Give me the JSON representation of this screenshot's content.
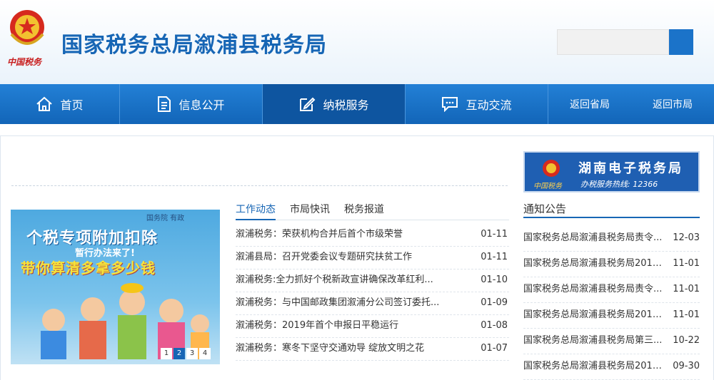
{
  "header": {
    "site_title": "国家税务总局溆浦县税务局",
    "emblem_caption": "中国税务"
  },
  "nav": [
    {
      "label": "首页",
      "icon": "home-icon"
    },
    {
      "label": "信息公开",
      "icon": "document-icon"
    },
    {
      "label": "纳税服务",
      "icon": "edit-icon"
    },
    {
      "label": "互动交流",
      "icon": "chat-icon"
    },
    {
      "label": "返回省局"
    },
    {
      "label": "返回市局"
    }
  ],
  "banner": {
    "brand": "国务院 有政",
    "line1": "个税专项附加扣除",
    "line2": "暂行办法来了!",
    "line3": "带你算清多拿多少钱",
    "pages": [
      "1",
      "2",
      "3",
      "4"
    ],
    "active_page": "2"
  },
  "news_tabs": [
    "工作动态",
    "市局快讯",
    "税务报道"
  ],
  "news": [
    {
      "title": "溆浦税务：荣获机构合并后首个市级荣誉",
      "date": "01-11"
    },
    {
      "title": "溆浦县局：召开党委会议专题研究扶贫工作",
      "date": "01-11"
    },
    {
      "title": "溆浦税务:全力抓好个税新政宣讲确保改革红利...",
      "date": "01-10"
    },
    {
      "title": "溆浦税务：与中国邮政集团溆浦分公司签订委托...",
      "date": "01-09"
    },
    {
      "title": "溆浦税务：2019年首个申报日平稳运行",
      "date": "01-08"
    },
    {
      "title": "溆浦税务：寒冬下坚守交通劝导 绽放文明之花",
      "date": "01-07"
    }
  ],
  "etax": {
    "title": "湖南电子税务局",
    "hotline": "办税服务热线: 12366",
    "logo_caption": "中国税务"
  },
  "notice_title": "通知公告",
  "notices": [
    {
      "title": "国家税务总局溆浦县税务局责令...",
      "date": "12-03"
    },
    {
      "title": "国家税务总局溆浦县税务局2018...",
      "date": "11-01"
    },
    {
      "title": "国家税务总局溆浦县税务局责令...",
      "date": "11-01"
    },
    {
      "title": "国家税务总局溆浦县税务局2018...",
      "date": "11-01"
    },
    {
      "title": "国家税务总局溆浦县税务局第三...",
      "date": "10-22"
    },
    {
      "title": "国家税务总局溆浦县税务局2018...",
      "date": "09-30"
    }
  ],
  "colors": {
    "brand_blue": "#1766b5",
    "nav_blue": "#1b73c9"
  }
}
